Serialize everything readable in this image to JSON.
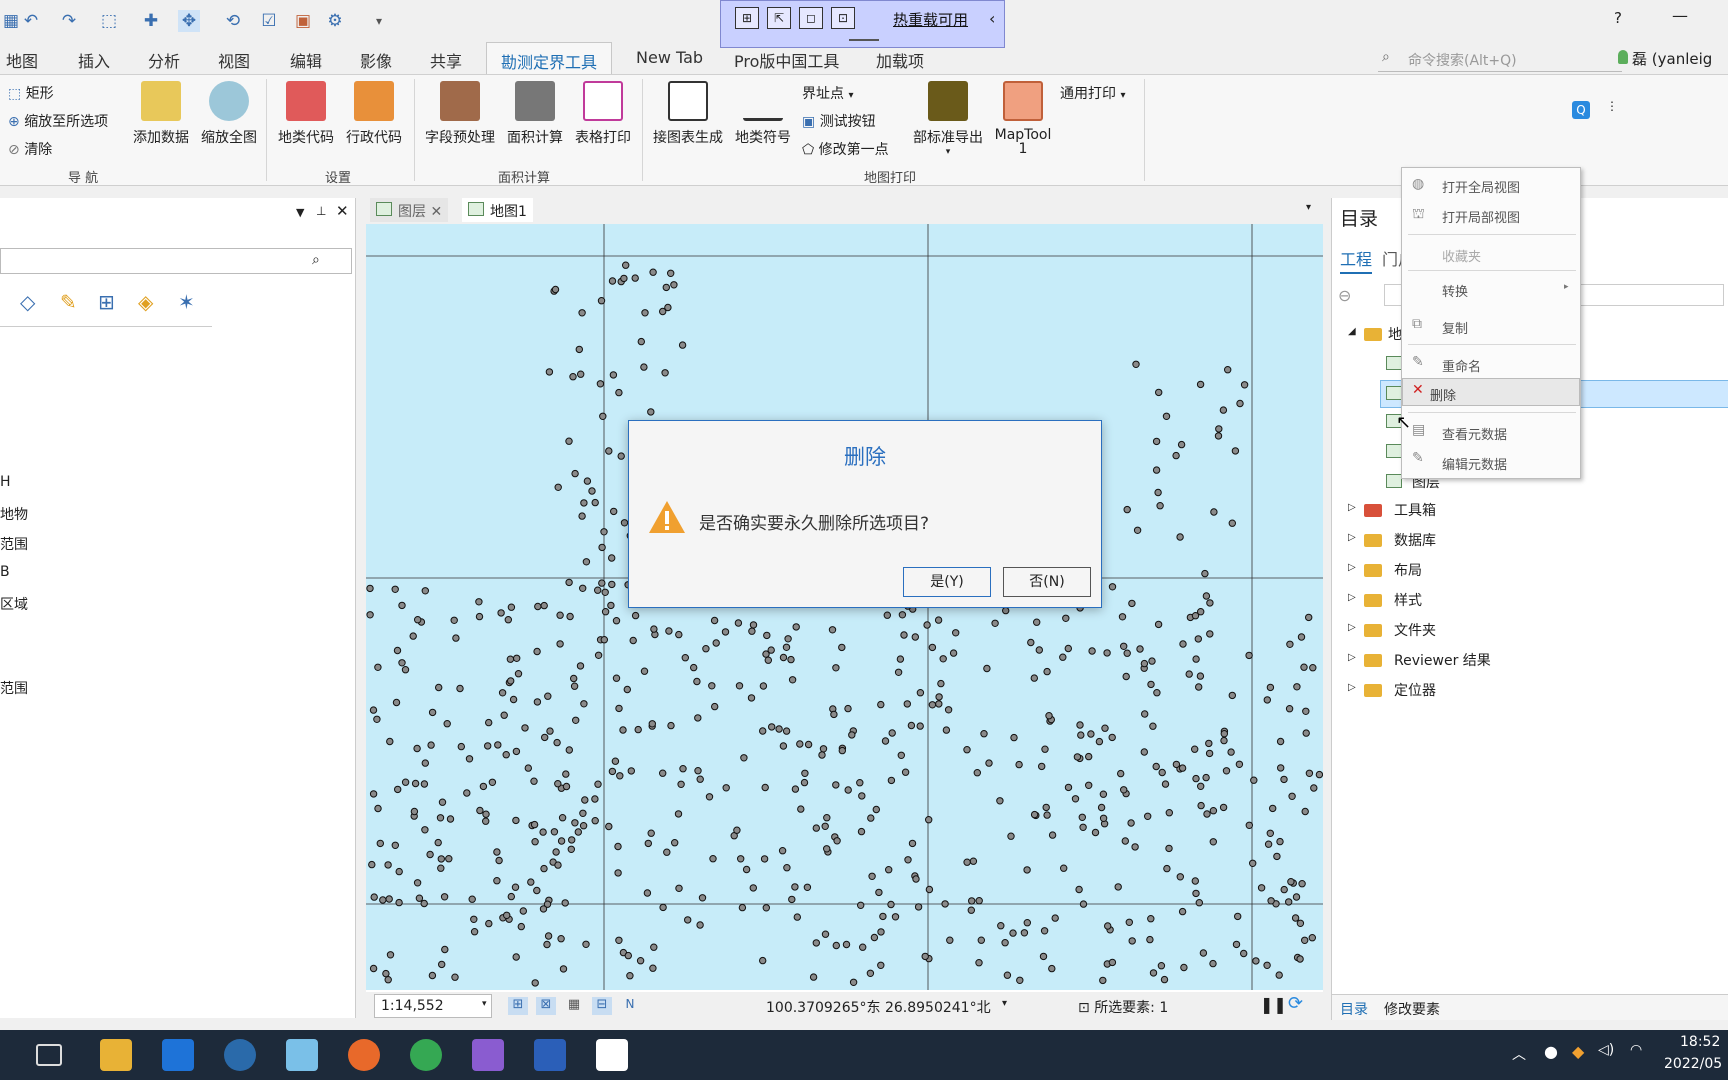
{
  "hotreload": {
    "label": "热重载可用"
  },
  "help": "?",
  "tabs": [
    "地图",
    "插入",
    "分析",
    "视图",
    "编辑",
    "影像",
    "共享",
    "勘测定界工具",
    "New Tab",
    "Pro版中国工具",
    "加载项"
  ],
  "search_placeholder": "命令搜索(Alt+Q)",
  "user": "磊 (yanleig",
  "ribbon": {
    "nav": {
      "rect": "矩形",
      "zoomsel": "缩放至所选项",
      "clear": "清除",
      "add": "添加数据",
      "full": "缩放全图",
      "group": "导 航"
    },
    "settings": {
      "land": "地类代码",
      "admin": "行政代码",
      "group": "设置"
    },
    "area": {
      "pre": "字段预处理",
      "calc": "面积计算",
      "print": "表格打印",
      "group": "面积计算"
    },
    "mapprint": {
      "sheet": "接图表生成",
      "symbol": "地类符号",
      "boundary": "界址点",
      "test": "测试按钮",
      "modify": "修改第一点",
      "export": "部标准导出",
      "maptool": "MapTool",
      "maptool2": "1",
      "general": "通用打印",
      "group": "地图打印"
    }
  },
  "left": {
    "items": [
      "H",
      "地物",
      "范围",
      "B",
      "区域",
      "范围"
    ]
  },
  "mapview": {
    "tab1": "图层",
    "tab2": "地图1",
    "scale": "1:14,552",
    "coords": "100.3709265°东 26.8950241°北",
    "selected": "所选要素: 1"
  },
  "catalog": {
    "title": "目录",
    "tab_project": "工程",
    "tab_portal": "门户",
    "tree_root": "地图",
    "layer": "图层",
    "items": [
      "工具箱",
      "数据库",
      "布局",
      "样式",
      "文件夹",
      "Reviewer 结果",
      "定位器"
    ],
    "bottom_tab1": "目录",
    "bottom_tab2": "修改要素"
  },
  "context": {
    "items": [
      "打开全局视图",
      "打开局部视图",
      "收藏夹",
      "转换",
      "复制",
      "重命名",
      "删除",
      "查看元数据",
      "编辑元数据"
    ]
  },
  "dialog": {
    "title": "删除",
    "message": "是否确实要永久删除所选项目?",
    "yes": "是(Y)",
    "no": "否(N)"
  },
  "clock": {
    "time": "18:52",
    "date": "2022/05"
  },
  "colors": {
    "accent": "#1f6fb4",
    "map_bg": "#c7ecf9",
    "dialog_border": "#2a6fbf",
    "selection": "#cde8ff"
  }
}
